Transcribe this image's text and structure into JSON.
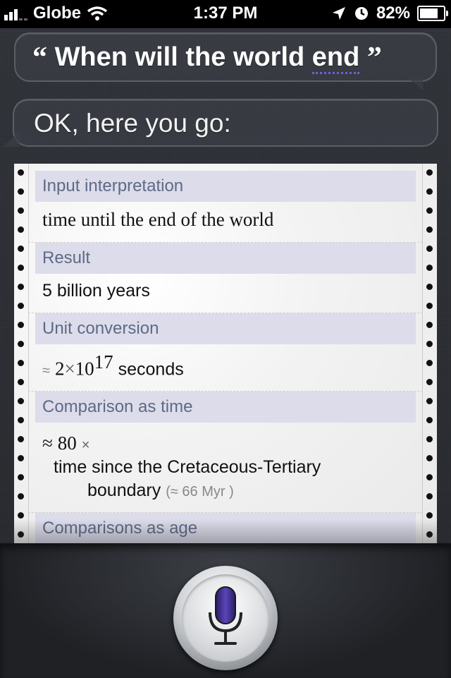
{
  "status_bar": {
    "carrier": "Globe",
    "time": "1:37 PM",
    "battery": "82%",
    "battery_level": 0.82,
    "signal_bars": 3,
    "icons": [
      "wifi-icon",
      "location-arrow-icon",
      "clock-icon",
      "battery-icon"
    ]
  },
  "conversation": {
    "query_open_quote": "“",
    "query_text_main": "When will the world ",
    "query_text_underlined": "end",
    "query_close_quote": "”",
    "reply": "OK, here you go:"
  },
  "wolfram_card": {
    "pods": [
      {
        "title": "Input interpretation",
        "body": "time until the end of the world"
      },
      {
        "title": "Result",
        "body": "5 billion years"
      },
      {
        "title": "Unit conversion",
        "approx": "≈",
        "mantissa": "2",
        "times": "×",
        "base": "10",
        "exponent": "17",
        "unit": "seconds"
      },
      {
        "title": "Comparison as time",
        "approx": "≈",
        "factor": "80",
        "times": "×",
        "line1": "time since the Cretaceous-Tertiary",
        "line2": "boundary",
        "note": "(≈ 66 Myr )"
      },
      {
        "title": "Comparisons as age"
      }
    ]
  },
  "colors": {
    "pod_title_bg": "#dcdcea",
    "pod_title_text": "#5e6a86",
    "underline": "#6a63d9",
    "mic_body": "#3a2a86"
  }
}
